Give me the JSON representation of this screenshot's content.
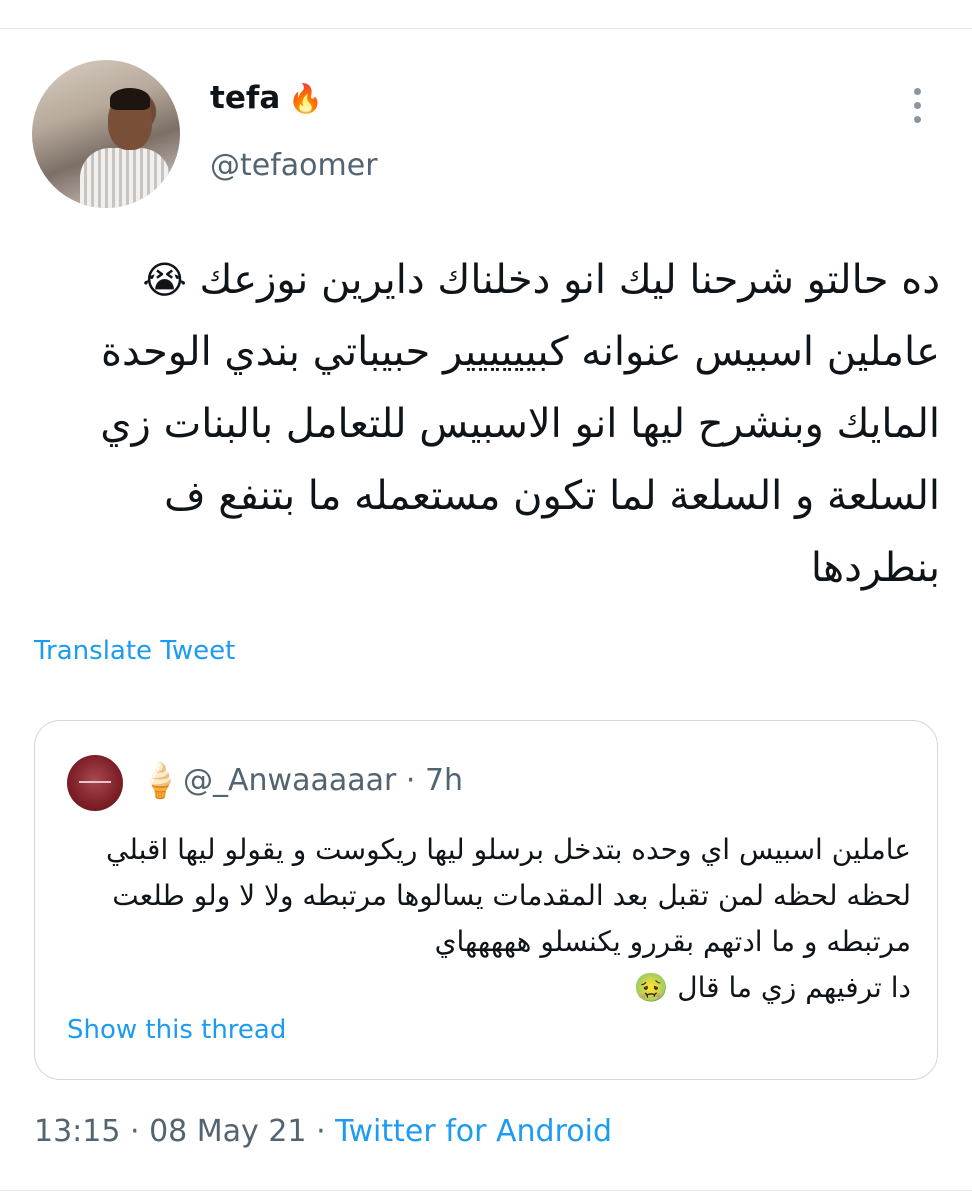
{
  "author": {
    "display_name": "tefa",
    "badge_emoji": "🔥",
    "handle": "@tefaomer"
  },
  "tweet": {
    "text": "ده حالتو شرحنا ليك انو دخلناك دايرين نوزعك",
    "emoji": "😭",
    "text_rest": "عاملين اسبيس عنوانه كبيييييير حبيباتي بندي الوحدة المايك وبنشرح ليها انو الاسبيس للتعامل بالبنات زي السلعة و السلعة لما تكون مستعمله ما بتنفع ف بنطردها",
    "translate_label": "Translate Tweet"
  },
  "quoted_tweet": {
    "icon_emoji": "🍦",
    "handle": "@_Anwaaaaar",
    "separator": "·",
    "time": "7h",
    "lines": [
      "عاملين اسبيس اي وحده بتدخل برسلو ليها ريكوست و يقولو ليها اقبلي",
      "لحظه لحظه لمن تقبل بعد المقدمات يسالوها مرتبطه ولا لا ولو طلعت",
      "مرتبطه و ما ادتهم بقررو يكنسلو هههههاي"
    ],
    "last_line": "دا ترفيهم زي ما قال",
    "last_emoji": "🤢",
    "show_thread_label": "Show this thread"
  },
  "meta": {
    "time": "13:15",
    "sep1": " · ",
    "date": "08 May 21",
    "sep2": " · ",
    "source": "Twitter for Android"
  },
  "colors": {
    "link": "#1d9bf0",
    "secondary_text": "#536471",
    "border": "#cfd9de"
  }
}
